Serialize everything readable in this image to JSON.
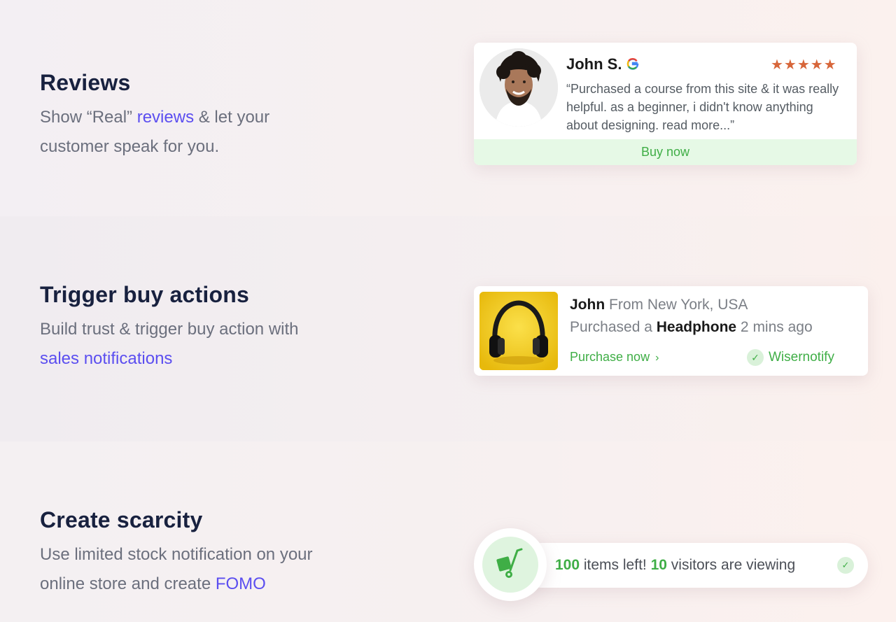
{
  "features": [
    {
      "heading": "Reviews",
      "desc_pre": "Show “Real” ",
      "desc_link": "reviews",
      "desc_mid": " & let your",
      "desc_post": "customer speak for you."
    },
    {
      "heading": "Trigger buy actions",
      "desc_pre": "Build trust & trigger buy action with",
      "desc_link": "sales notifications"
    },
    {
      "heading": "Create scarcity",
      "desc_pre": "Use limited stock notification on your",
      "desc_mid": "online store and create ",
      "desc_link": "FOMO"
    }
  ],
  "review_card": {
    "name": "John S.",
    "stars": "★★★★★",
    "text": "“Purchased a course from this site & it was really helpful. as a beginner, i didn't know anything about designing. read more...”",
    "cta": "Buy now",
    "icons": [
      "avatar-photo",
      "google-icon",
      "star-icon"
    ]
  },
  "sales_card": {
    "name": "John",
    "location": " From New York, USA",
    "purchased": "Purchased a ",
    "product": "Headphone",
    "time": " 2 mins ago",
    "cta": "Purchase now",
    "chevron": "›",
    "check": "✓",
    "brand": "Wisernotify",
    "icons": [
      "headphone-image",
      "chevron-right-icon",
      "check-circle-icon"
    ]
  },
  "scarcity": {
    "items": "100",
    "items_text": " items left! ",
    "visitors": "10",
    "visitors_text": " visitors are viewing",
    "check": "✓",
    "icons": [
      "cart-icon",
      "check-circle-icon"
    ]
  },
  "colors": {
    "heading": "#18213f",
    "body": "#6b6f7d",
    "link": "#5b4ef0",
    "green": "#3fae46",
    "star": "#d7663a"
  }
}
